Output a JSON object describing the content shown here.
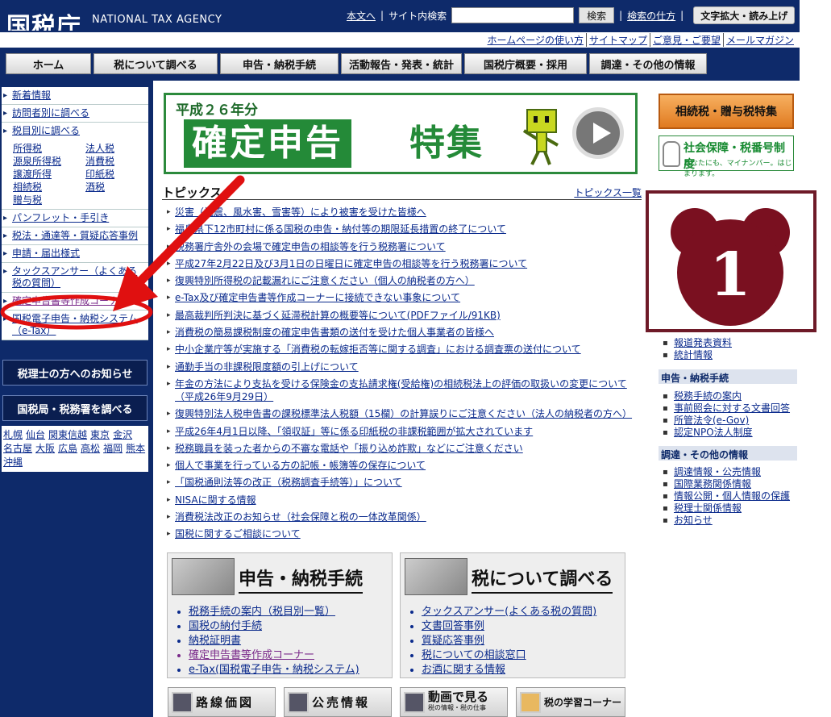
{
  "header": {
    "logo": "国税庁",
    "logo_en": "NATIONAL TAX AGENCY",
    "skip_link": "本文へ",
    "search_label": "サイト内検索",
    "search_button": "検索",
    "search_help": "検索の仕方",
    "fontsize_button": "文字拡大・読み上げ",
    "sublinks": [
      "ホームページの使い方",
      "サイトマップ",
      "ご意見・ご要望",
      "メールマガジン"
    ],
    "nav": [
      "ホーム",
      "税について調べる",
      "申告・納税手続",
      "活動報告・発表・統計",
      "国税庁概要・採用",
      "調達・その他の情報"
    ]
  },
  "sidebar": {
    "items_top": [
      "新着情報",
      "訪問者別に調べる",
      "税目別に調べる"
    ],
    "tax_items": [
      "所得税",
      "法人税",
      "源泉所得税",
      "消費税",
      "譲渡所得",
      "印紙税",
      "相続税",
      "酒税",
      "贈与税"
    ],
    "items_bottom": [
      "パンフレット・手引き",
      "税法・通達等・質疑応答事例",
      "申請・届出様式",
      "タックスアンサー（よくある税の質問）",
      "確定申告書等作成コーナー",
      "国税電子申告・納税システム（e-Tax）"
    ],
    "tax_accountant_button": "税理士の方へのお知らせ",
    "bureau_button": "国税局・税務署を調べる",
    "cities": [
      "札幌",
      "仙台",
      "関東信越",
      "東京",
      "金沢",
      "名古屋",
      "大阪",
      "広島",
      "高松",
      "福岡",
      "熊本",
      "沖縄"
    ]
  },
  "banner": {
    "subtitle": "平成２６年分",
    "title_main": "確定申告",
    "title_tail": "特集"
  },
  "topics": {
    "title": "トピックス",
    "all_link": "トピックス一覧",
    "items": [
      "災害（地震、風水害、雪害等）により被害を受けた皆様へ",
      "福島県下12市町村に係る国税の申告・納付等の期限延長措置の終了について",
      "税務署庁舎外の会場で確定申告の相談等を行う税務署について",
      "平成27年2月22日及び3月1日の日曜日に確定申告の相談等を行う税務署について",
      "復興特別所得税の記載漏れにご注意ください（個人の納税者の方へ）",
      "e-Tax及び確定申告書等作成コーナーに接続できない事象について",
      "最高裁判所判決に基づく延滞税計算の概要等について(PDFファイル/91KB)",
      "消費税の簡易課税制度の確定申告書類の送付を受けた個人事業者の皆様へ",
      "中小企業庁等が実施する「消費税の転嫁拒否等に関する調査」における調査票の送付について",
      "通勤手当の非課税限度額の引上げについて",
      "年金の方法により支払を受ける保険金の支払請求権(受給権)の相続税法上の評価の取扱いの変更について（平成26年9月29日）",
      "復興特別法人税申告書の課税標準法人税額（15欄）の計算誤りにご注意ください（法人の納税者の方へ）",
      "平成26年4月1日以降、「領収証」等に係る印紙税の非課税範囲が拡大されています",
      "税務職員を装った者からの不審な電話や「振り込め詐欺」などにご注意ください",
      "個人で事業を行っている方の記帳・帳簿等の保存について",
      "「国税通則法等の改正（税務調査手続等）」について",
      "NISAに関する情報",
      "消費税法改正のお知らせ（社会保障と税の一体改革関係）",
      "国税に関するご相談について"
    ]
  },
  "panels": {
    "filing": {
      "title": "申告・納税手続",
      "links": [
        "税務手続の案内（税目別一覧）",
        "国税の納付手続",
        "納税証明書",
        "確定申告書等作成コーナー",
        "e-Tax(国税電子申告・納税システム)"
      ]
    },
    "research": {
      "title": "税について調べる",
      "links": [
        "タックスアンサー(よくある税の質問)",
        "文書回答事例",
        "質疑応答事例",
        "税についての相談窓口",
        "お酒に関する情報"
      ]
    }
  },
  "bottom_buttons": [
    "路線価図",
    "公売情報",
    "動画で見る",
    "税の学習コーナー"
  ],
  "bottom_video_sub": "税の情報・税の仕事",
  "right": {
    "special_button": "相続税・贈与税特集",
    "mynumber_title": "社会保障・税番号制度",
    "mynumber_sub": "あなたにも、マイナンバー。はじまります。",
    "badge_number": "1",
    "links_1": [
      "報道発表資料",
      "統計情報"
    ],
    "section_filing": "申告・納税手続",
    "links_filing": [
      "税務手続の案内",
      "事前照会に対する文書回答",
      "所管法令(e-Gov)",
      "認定NPO法人制度"
    ],
    "section_other": "調達・その他の情報",
    "links_other": [
      "調達情報・公売情報",
      "国際業務関係情報",
      "情報公開・個人情報の保護",
      "税理士関係情報",
      "お知らせ"
    ]
  },
  "colors": {
    "header_bg": "#0e2a6a",
    "annotation_red": "#e01010",
    "badge_maroon": "#7a1020",
    "banner_green": "#248a38"
  }
}
